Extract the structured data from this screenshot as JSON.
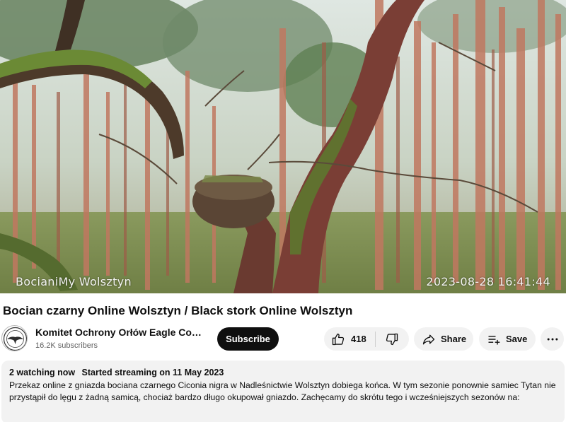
{
  "video": {
    "watermark": "BocianiMy Wolsztyn",
    "timestamp": "2023-08-28 16:41:44"
  },
  "title": "Bocian czarny Online Wolsztyn / Black stork Online Wolsztyn",
  "channel": {
    "name": "Komitet Ochrony Orłów Eagle Con...",
    "subscribers": "16.2K subscribers",
    "avatar_icon": "eagle-logo-icon"
  },
  "actions": {
    "subscribe_label": "Subscribe",
    "like_count": "418",
    "share_label": "Share",
    "save_label": "Save",
    "icons": [
      "thumb-up-icon",
      "thumb-down-icon",
      "share-arrow-icon",
      "playlist-add-icon",
      "more-dots-icon"
    ]
  },
  "description": {
    "watching": "2 watching now",
    "started": "Started streaming on 11 May 2023",
    "text": "Przekaz online z gniazda bociana czarnego Ciconia nigra w Nadleśnictwie Wolsztyn dobiega końca. W tym sezonie ponownie samiec Tytan nie przystąpił do lęgu z żadną samicą, chociaż bardzo długo okupował gniazdo. Zachęcamy do skrótu tego i wcześniejszych sezonów na:"
  },
  "colors": {
    "button_dark": "#0f0f0f",
    "pill_bg": "#f2f2f2",
    "secondary_text": "#606060"
  }
}
